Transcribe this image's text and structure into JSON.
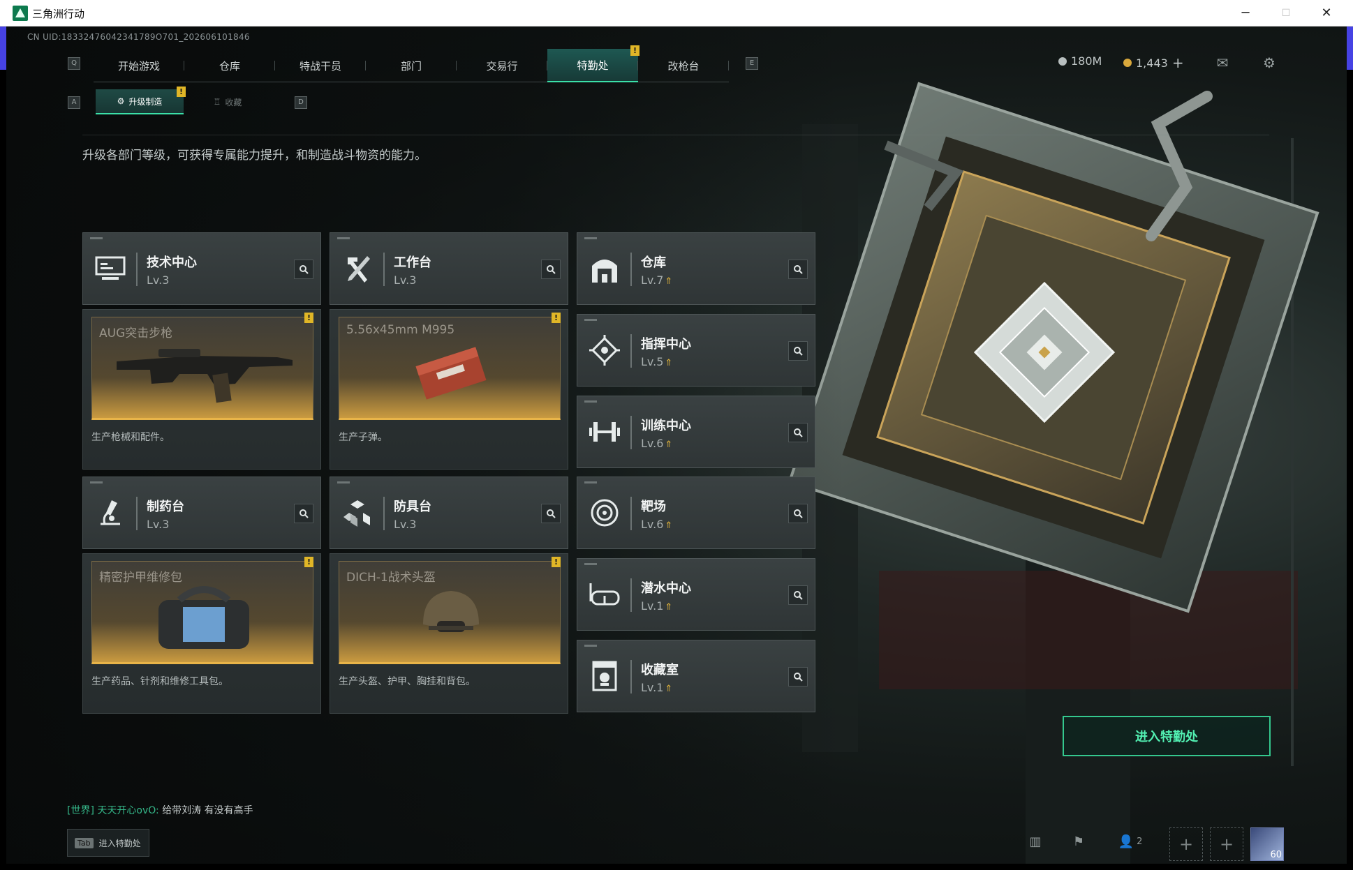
{
  "window": {
    "title": "三角洲行动",
    "minimize": "─",
    "maximize": "☐",
    "close": "✕"
  },
  "uid": "CN UID:18332476042341789O701_202606101846",
  "nav": {
    "key_left": "Q",
    "key_right": "E",
    "tabs": [
      "开始游戏",
      "仓库",
      "特战干员",
      "部门",
      "交易行",
      "特勤处",
      "改枪台"
    ],
    "active": "特勤处",
    "badge": "!"
  },
  "currency": {
    "silver": "180M",
    "gold": "1,443",
    "add": "+"
  },
  "subtabs": {
    "key_left": "A",
    "key_right": "D",
    "active": "升级制造",
    "inactive": "收藏",
    "badge": "!"
  },
  "description": "升级各部门等级，可获得专属能力提升，和制造战斗物资的能力。",
  "departments": [
    {
      "name": "技术中心",
      "level": "Lv.3",
      "icon": "computer-icon",
      "upgradable": false
    },
    {
      "name": "工作台",
      "level": "Lv.3",
      "icon": "hammer-wrench-icon",
      "upgradable": false
    },
    {
      "name": "仓库",
      "level": "Lv.7",
      "icon": "warehouse-icon",
      "upgradable": true
    },
    {
      "name": "指挥中心",
      "level": "Lv.5",
      "icon": "command-icon",
      "upgradable": true
    },
    {
      "name": "训练中心",
      "level": "Lv.6",
      "icon": "dumbbell-icon",
      "upgradable": true
    },
    {
      "name": "制药台",
      "level": "Lv.3",
      "icon": "microscope-icon",
      "upgradable": false
    },
    {
      "name": "防具台",
      "level": "Lv.3",
      "icon": "armor-blocks-icon",
      "upgradable": false
    },
    {
      "name": "靶场",
      "level": "Lv.6",
      "icon": "target-icon",
      "upgradable": true
    },
    {
      "name": "潜水中心",
      "level": "Lv.1",
      "icon": "diving-mask-icon",
      "upgradable": true
    },
    {
      "name": "收藏室",
      "level": "Lv.1",
      "icon": "trophy-case-icon",
      "upgradable": true
    }
  ],
  "production": [
    {
      "item": "AUG突击步枪",
      "desc": "生产枪械和配件。",
      "badge": "!"
    },
    {
      "item": "5.56x45mm M995",
      "desc": "生产子弹。",
      "badge": "!"
    },
    {
      "item": "精密护甲维修包",
      "desc": "生产药品、针剂和维修工具包。",
      "badge": "!"
    },
    {
      "item": "DICH-1战术头盔",
      "desc": "生产头盔、护甲、胸挂和背包。",
      "badge": "!"
    }
  ],
  "enter_button": "进入特勤处",
  "chat": {
    "channel": "[世界]",
    "user": "天天开心ovO:",
    "message": "给带刘涛  有没有高手"
  },
  "tab_hint": {
    "key": "Tab",
    "label": "进入特勤处"
  },
  "bottom": {
    "friends_count": "2",
    "level": "60"
  },
  "colors": {
    "accent": "#3be0a8",
    "badge": "#e0b627",
    "upgrade_arrow": "#e2b43a"
  }
}
